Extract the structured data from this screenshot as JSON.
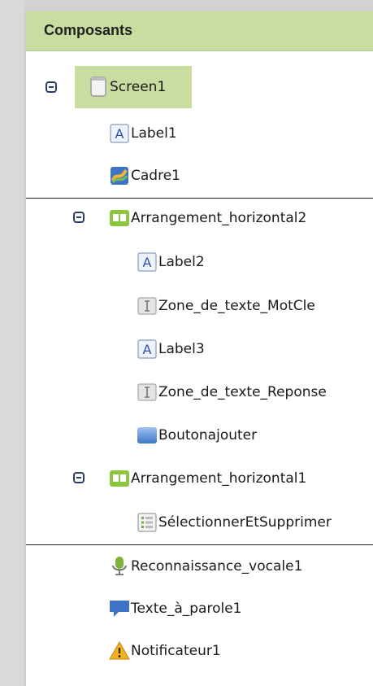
{
  "panel": {
    "title": "Composants"
  },
  "tree": {
    "screen1": "Screen1",
    "label1": "Label1",
    "cadre1": "Cadre1",
    "arr_h2": "Arrangement_horizontal2",
    "label2": "Label2",
    "zone_mot": "Zone_de_texte_MotCle",
    "label3": "Label3",
    "zone_rep": "Zone_de_texte_Reponse",
    "bouton": "Boutonajouter",
    "arr_h1": "Arrangement_horizontal1",
    "selectionner": "SélectionnerEtSupprimer",
    "reco": "Reconnaissance_vocale1",
    "tts": "Texte_à_parole1",
    "notif": "Notificateur1"
  },
  "colors": {
    "header_bg": "#c8dd9f",
    "toggle": "#2c3e63"
  }
}
